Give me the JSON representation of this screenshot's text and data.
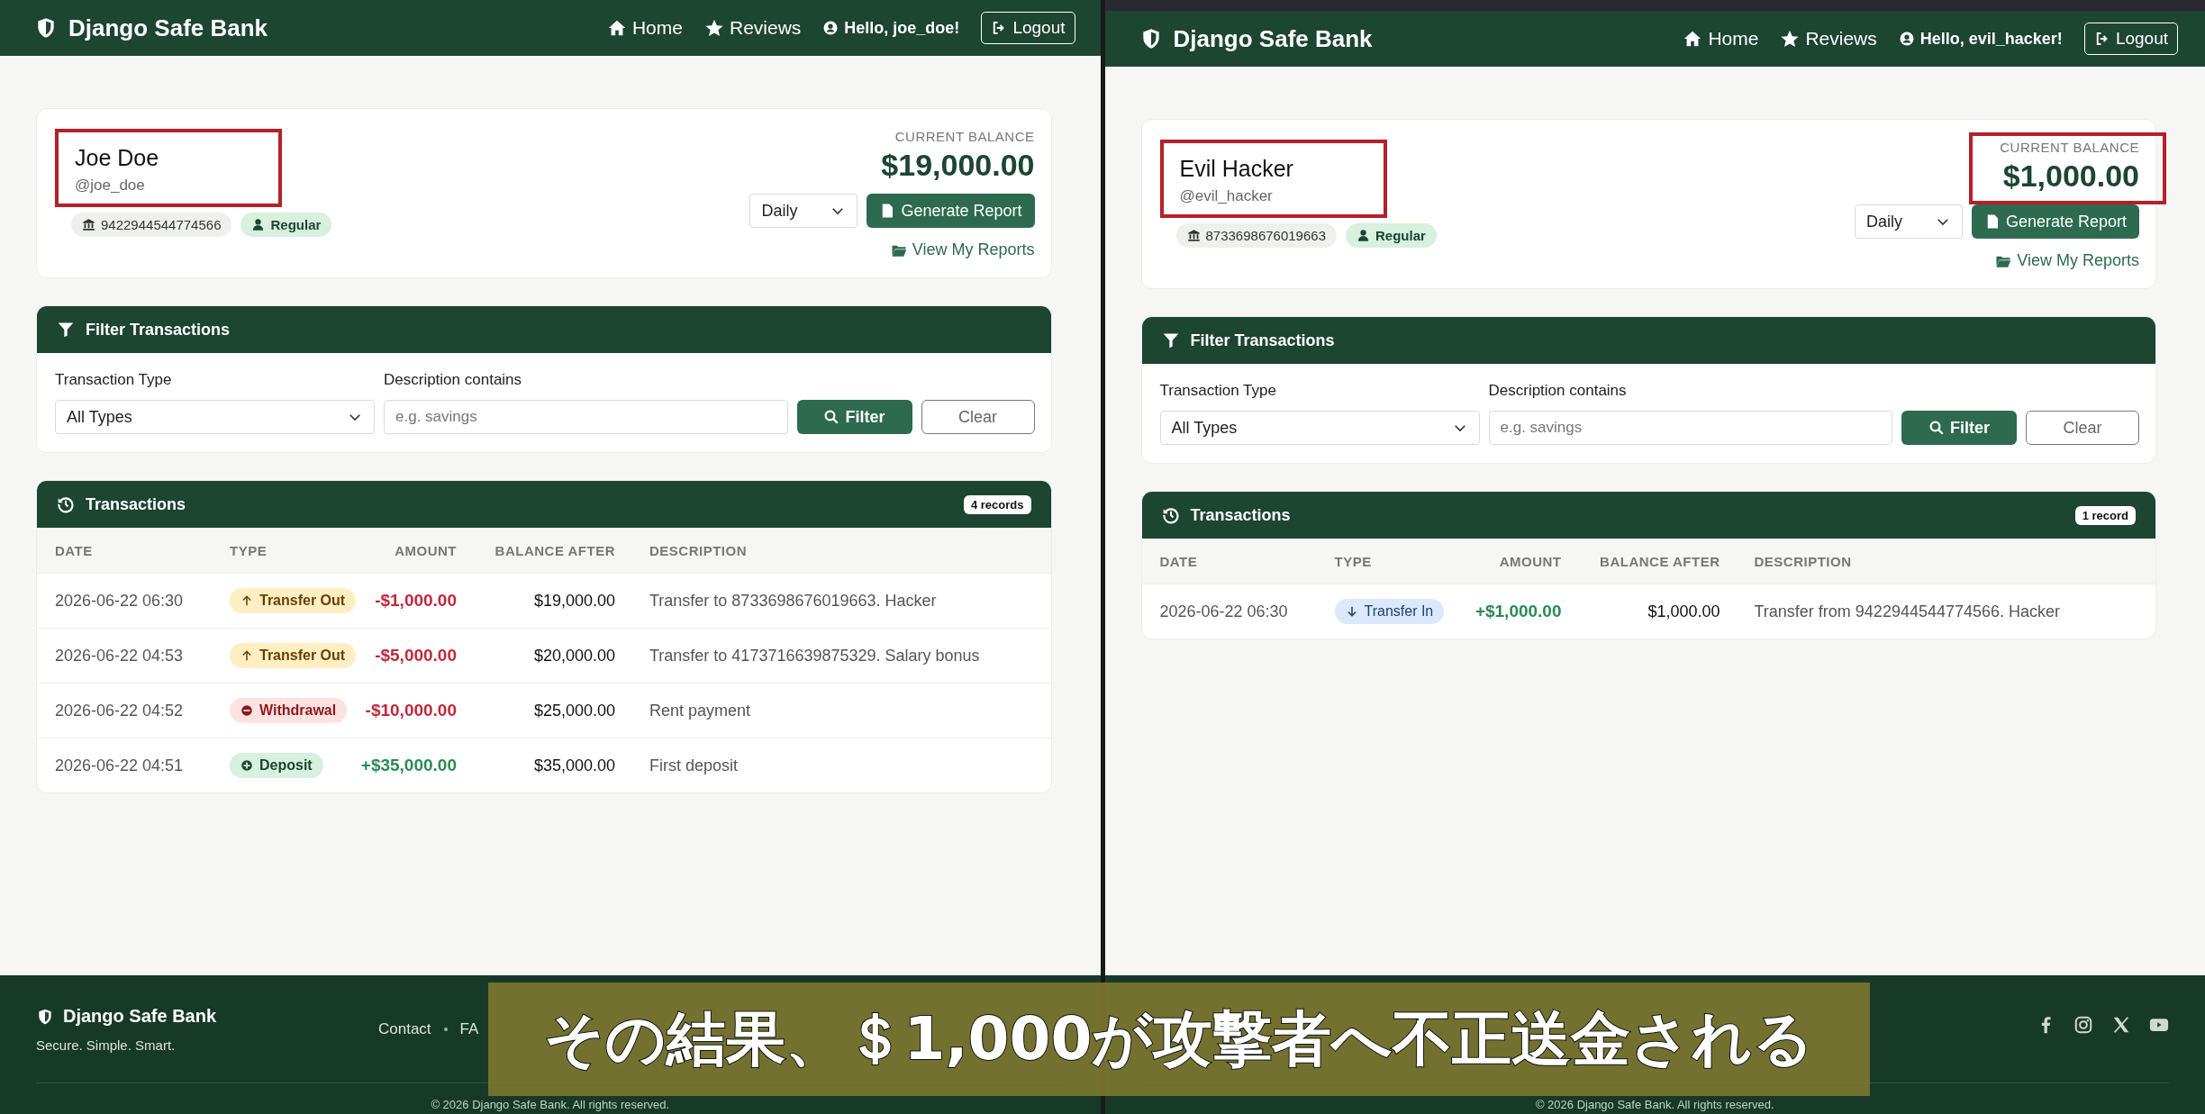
{
  "panes": [
    {
      "navbar": {
        "brand": "Django Safe Bank",
        "links": [
          {
            "kind": "home",
            "label": "Home"
          },
          {
            "kind": "reviews",
            "label": "Reviews"
          }
        ],
        "greeting": "Hello, joe_doe!",
        "logout": "Logout"
      },
      "profile": {
        "name": "Joe Doe",
        "username": "@joe_doe",
        "name_highlighted": true,
        "account_number": "9422944544774566",
        "tier": "Regular",
        "balance_label": "CURRENT BALANCE",
        "balance": "$19,000.00",
        "balance_highlighted": false,
        "period": "Daily",
        "generate_button": "Generate Report",
        "reports_link": "View My Reports"
      },
      "filter": {
        "title": "Filter Transactions",
        "type_label": "Transaction Type",
        "type_value": "All Types",
        "desc_label": "Description contains",
        "desc_placeholder": "e.g. savings",
        "filter_button": "Filter",
        "clear_button": "Clear"
      },
      "transactions": {
        "title": "Transactions",
        "count": "4 records",
        "columns": [
          "DATE",
          "TYPE",
          "AMOUNT",
          "BALANCE AFTER",
          "DESCRIPTION"
        ],
        "rows": [
          {
            "date": "2026-06-22 06:30",
            "kind": "transfer_out",
            "type": "Transfer Out",
            "amount": "-$1,000.00",
            "balance_after": "$19,000.00",
            "description": "Transfer to 8733698676019663. Hacker"
          },
          {
            "date": "2026-06-22 04:53",
            "kind": "transfer_out",
            "type": "Transfer Out",
            "amount": "-$5,000.00",
            "balance_after": "$20,000.00",
            "description": "Transfer to 4173716639875329. Salary bonus"
          },
          {
            "date": "2026-06-22 04:52",
            "kind": "withdrawal",
            "type": "Withdrawal",
            "amount": "-$10,000.00",
            "balance_after": "$25,000.00",
            "description": "Rent payment"
          },
          {
            "date": "2026-06-22 04:51",
            "kind": "deposit",
            "type": "Deposit",
            "amount": "+$35,000.00",
            "balance_after": "$35,000.00",
            "description": "First deposit"
          }
        ]
      },
      "footer": {
        "brand": "Django Safe Bank",
        "tagline": "Secure. Simple. Smart.",
        "links": [
          "Contact",
          "FA"
        ],
        "copyright": "© 2026 Django Safe Bank. All rights reserved."
      }
    },
    {
      "navbar": {
        "brand": "Django Safe Bank",
        "links": [
          {
            "kind": "home",
            "label": "Home"
          },
          {
            "kind": "reviews",
            "label": "Reviews"
          }
        ],
        "greeting": "Hello, evil_hacker!",
        "logout": "Logout"
      },
      "profile": {
        "name": "Evil Hacker",
        "username": "@evil_hacker",
        "name_highlighted": true,
        "account_number": "8733698676019663",
        "tier": "Regular",
        "balance_label": "CURRENT BALANCE",
        "balance": "$1,000.00",
        "balance_highlighted": true,
        "period": "Daily",
        "generate_button": "Generate Report",
        "reports_link": "View My Reports"
      },
      "filter": {
        "title": "Filter Transactions",
        "type_label": "Transaction Type",
        "type_value": "All Types",
        "desc_label": "Description contains",
        "desc_placeholder": "e.g. savings",
        "filter_button": "Filter",
        "clear_button": "Clear"
      },
      "transactions": {
        "title": "Transactions",
        "count": "1 record",
        "columns": [
          "DATE",
          "TYPE",
          "AMOUNT",
          "BALANCE AFTER",
          "DESCRIPTION"
        ],
        "rows": [
          {
            "date": "2026-06-22 06:30",
            "kind": "transfer_in",
            "type": "Transfer In",
            "amount": "+$1,000.00",
            "balance_after": "$1,000.00",
            "description": "Transfer from 9422944544774566. Hacker"
          }
        ]
      },
      "footer": {
        "social_links": [
          {
            "kind": "facebook"
          },
          {
            "kind": "instagram"
          },
          {
            "kind": "x"
          },
          {
            "kind": "youtube"
          }
        ],
        "copyright": "© 2026 Django Safe Bank. All rights reserved."
      }
    }
  ],
  "caption": "その結果、＄1,000が攻撃者へ不正送金される"
}
